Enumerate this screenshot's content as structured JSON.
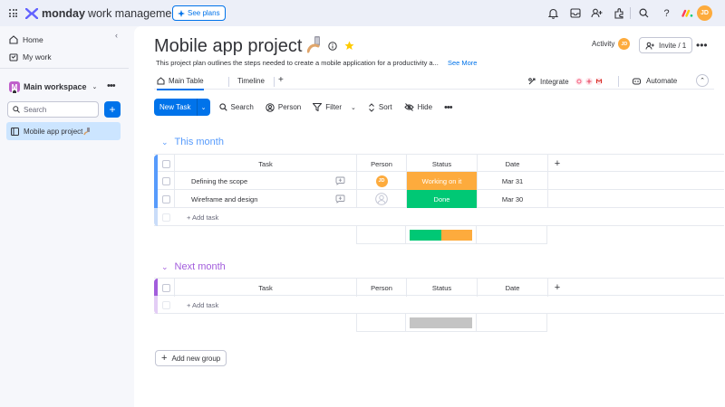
{
  "topbar": {
    "brand": "monday",
    "product": "work management",
    "see_plans": "See plans",
    "avatar": "JD",
    "icons": [
      "bell-icon",
      "inbox-icon",
      "invite-members-icon",
      "apps-icon",
      "search-icon",
      "help-icon",
      "monday-icon"
    ]
  },
  "sidebar": {
    "home": "Home",
    "my_work": "My work",
    "workspace_badge": "M",
    "workspace_name": "Main workspace",
    "search_placeholder": "Search",
    "add_label": "+",
    "board_item": "Mobile app project"
  },
  "board": {
    "title": "Mobile app project",
    "description": "This project plan outlines the steps needed to create a mobile application for a productivity a...",
    "see_more": "See More",
    "activity": "Activity",
    "activity_avatar": "JD",
    "invite": "Invite / 1",
    "tabs": [
      {
        "label": "Main Table"
      },
      {
        "label": "Timeline"
      },
      {
        "label": "+"
      }
    ],
    "integrate": "Integrate",
    "automate": "Automate"
  },
  "toolbar": {
    "new_task": "New Task",
    "search": "Search",
    "person": "Person",
    "filter": "Filter",
    "sort": "Sort",
    "hide": "Hide"
  },
  "columns": {
    "task": "Task",
    "person": "Person",
    "status": "Status",
    "date": "Date",
    "add": "+"
  },
  "groups": [
    {
      "title": "This month",
      "color": "#579bfc",
      "rows": [
        {
          "task": "Defining the scope",
          "person": "JD",
          "status": "Working on it",
          "status_color": "#fdab3d",
          "date": "Mar 31"
        },
        {
          "task": "Wireframe and design",
          "person": "",
          "status": "Done",
          "status_color": "#00c875",
          "date": "Mar 30"
        }
      ],
      "add_task": "+ Add task",
      "status_summary": [
        {
          "color": "#00c875",
          "share": 0.5
        },
        {
          "color": "#fdab3d",
          "share": 0.5
        }
      ]
    },
    {
      "title": "Next month",
      "color": "#a25ddc",
      "rows": [],
      "add_task": "+ Add task",
      "status_summary": [
        {
          "color": "#c4c4c4",
          "share": 1
        }
      ]
    }
  ],
  "add_group": "Add new group",
  "colors": {
    "accent": "#0073ea",
    "selected_board_bg": "#cce5ff",
    "working_on_it": "#fdab3d",
    "done": "#00c875"
  }
}
